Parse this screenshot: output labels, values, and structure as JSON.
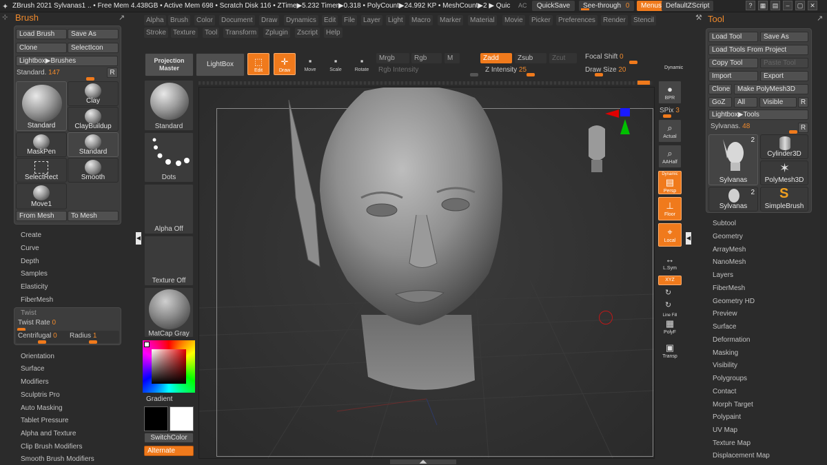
{
  "titlebar": {
    "text": "ZBrush 2021   Sylvanas1   .. • Free Mem 4.438GB • Active Mem 698 • Scratch Disk 116 • ZTime▶5.232 Timer▶0.318 • PolyCount▶24.992 KP • MeshCount▶2 ▶ Quic",
    "ac": "AC",
    "quicksave": "QuickSave",
    "seethrough_label": "See-through",
    "seethrough_value": "0",
    "menus": "Menus",
    "script": "DefaultZScript"
  },
  "menubar": [
    "Alpha",
    "Brush",
    "Color",
    "Document",
    "Draw",
    "Dynamics",
    "Edit",
    "File",
    "Layer",
    "Light",
    "Macro",
    "Marker",
    "Material",
    "Movie",
    "Picker",
    "Preferences",
    "Render",
    "Stencil"
  ],
  "menubar2": [
    "Stroke",
    "Texture",
    "Tool",
    "Transform",
    "Zplugin",
    "Zscript",
    "Help"
  ],
  "brush_panel": {
    "title": "Brush",
    "load_brush": "Load Brush",
    "save_as": "Save As",
    "clone": "Clone",
    "select_icon": "SelectIcon",
    "lightbox": "Lightbox▶Brushes",
    "standard_label": "Standard.",
    "standard_value": "147",
    "r": "R",
    "brushes": [
      "Standard",
      "Clay",
      "ClayBuildup",
      "MaskPen",
      "Standard",
      "SelectRect",
      "Smooth",
      "Move1"
    ],
    "from_mesh": "From Mesh",
    "to_mesh": "To Mesh",
    "sections": [
      "Create",
      "Curve",
      "Depth",
      "Samples",
      "Elasticity",
      "FiberMesh"
    ],
    "twist_title": "Twist",
    "twist_rate_label": "Twist Rate",
    "twist_rate_value": "0",
    "centrifugal_label": "Centrifugal",
    "centrifugal_value": "0",
    "radius_label": "Radius",
    "radius_value": "1",
    "sections2": [
      "Orientation",
      "Surface",
      "Modifiers",
      "Sculptris Pro",
      "Auto Masking",
      "Tablet Pressure",
      "Alpha and Texture",
      "Clip Brush Modifiers",
      "Smooth Brush Modifiers"
    ]
  },
  "shelf": {
    "projection_master": "Projection Master",
    "lightbox": "LightBox",
    "standard": "Standard",
    "dots": "Dots",
    "alpha_off": "Alpha Off",
    "texture_off": "Texture Off",
    "matcap": "MatCap Gray",
    "gradient": "Gradient",
    "switch_color": "SwitchColor",
    "alternate": "Alternate"
  },
  "toolbar": {
    "edit": "Edit",
    "draw": "Draw",
    "move": "Move",
    "scale": "Scale",
    "rotate": "Rotate",
    "mrgb": "Mrgb",
    "rgb": "Rgb",
    "m": "M",
    "rgb_intensity": "Rgb Intensity",
    "zadd": "Zadd",
    "zsub": "Zsub",
    "zcut": "Zcut",
    "z_intensity_label": "Z Intensity",
    "z_intensity_value": "25",
    "focal_shift_label": "Focal Shift",
    "focal_shift_value": "0",
    "draw_size_label": "Draw Size",
    "draw_size_value": "20",
    "dynamic": "Dynamic"
  },
  "right_shelf": {
    "bpr": "BPR",
    "spix_label": "SPix",
    "spix_value": "3",
    "actual": "Actual",
    "aahalf": "AAHalf",
    "persp": "Persp",
    "floor": "Floor",
    "local": "Local",
    "lsym": "L.Sym",
    "xyz": "XYZ",
    "polyf": "PolyF",
    "line_fill": "Line Fill",
    "transp": "Transp",
    "dynamic": "Dynamic"
  },
  "tool_panel": {
    "title": "Tool",
    "load_tool": "Load Tool",
    "save_as": "Save As",
    "load_from_project": "Load Tools From Project",
    "copy_tool": "Copy Tool",
    "paste_tool": "Paste Tool",
    "import": "Import",
    "export": "Export",
    "clone": "Clone",
    "make_polymesh": "Make PolyMesh3D",
    "goz": "GoZ",
    "all": "All",
    "visible": "Visible",
    "r": "R",
    "lightbox": "Lightbox▶Tools",
    "sylvanas_label": "Sylvanas.",
    "sylvanas_value": "48",
    "tools": [
      "Sylvanas",
      "Cylinder3D",
      "PolyMesh3D",
      "Sylvanas",
      "SimpleBrush"
    ],
    "tool_count_1": "2",
    "tool_count_2": "2",
    "sections": [
      "Subtool",
      "Geometry",
      "ArrayMesh",
      "NanoMesh",
      "Layers",
      "FiberMesh",
      "Geometry HD",
      "Preview",
      "Surface",
      "Deformation",
      "Masking",
      "Visibility",
      "Polygroups",
      "Contact",
      "Morph Target",
      "Polypaint",
      "UV Map",
      "Texture Map",
      "Displacement Map"
    ]
  }
}
